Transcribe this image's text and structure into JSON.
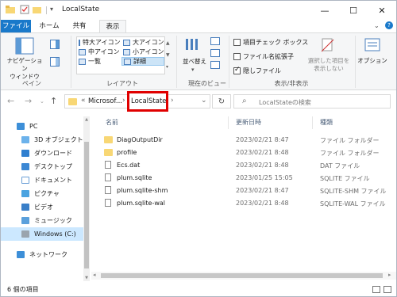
{
  "window": {
    "title": "LocalState",
    "minimize": "—",
    "maximize": "☐",
    "close": "✕"
  },
  "tabs": [
    {
      "label": "ファイル"
    },
    {
      "label": "ホーム"
    },
    {
      "label": "共有"
    },
    {
      "label": "表示"
    }
  ],
  "ribbon": {
    "pane": {
      "nav_pane_label": "ナビゲーション\nウィンドウ",
      "group_label": "ペイン"
    },
    "layout": {
      "items": [
        "特大アイコン",
        "大アイコン",
        "中アイコン",
        "小アイコン",
        "一覧",
        "詳細"
      ],
      "selected": "詳細",
      "group_label": "レイアウト"
    },
    "current_view": {
      "sort_label": "並べ替え",
      "group_label": "現在のビュー"
    },
    "show_hide": {
      "item_checkbox": "項目チェック ボックス",
      "extensions": "ファイル名拡張子",
      "hidden_items": "隠しファイル",
      "hide_selected": "選択した項目を\n表示しない",
      "group_label": "表示/非表示"
    },
    "options_label": "オプション"
  },
  "address": {
    "crumb_parent": "Microsof...",
    "crumb_current": "LocalState",
    "search_placeholder": "LocalStateの検索"
  },
  "sidebar": {
    "items": [
      {
        "label": "PC",
        "icon": "pc-icon"
      },
      {
        "label": "3D オブジェクト",
        "icon": "3d-objects-icon"
      },
      {
        "label": "ダウンロード",
        "icon": "download-icon"
      },
      {
        "label": "デスクトップ",
        "icon": "desktop-icon"
      },
      {
        "label": "ドキュメント",
        "icon": "documents-icon"
      },
      {
        "label": "ピクチャ",
        "icon": "pictures-icon"
      },
      {
        "label": "ビデオ",
        "icon": "video-icon"
      },
      {
        "label": "ミュージック",
        "icon": "music-icon"
      },
      {
        "label": "Windows (C:)",
        "icon": "drive-icon"
      },
      {
        "label": "ネットワーク",
        "icon": "network-icon"
      }
    ]
  },
  "list": {
    "headers": {
      "name": "名前",
      "date": "更新日時",
      "type": "種類"
    },
    "rows": [
      {
        "name": "DiagOutputDir",
        "date": "2023/02/21 8:47",
        "type": "ファイル フォルダー",
        "kind": "folder"
      },
      {
        "name": "profile",
        "date": "2023/02/21 8:48",
        "type": "ファイル フォルダー",
        "kind": "folder"
      },
      {
        "name": "Ecs.dat",
        "date": "2023/02/21 8:48",
        "type": "DAT ファイル",
        "kind": "file"
      },
      {
        "name": "plum.sqlite",
        "date": "2023/01/25 15:05",
        "type": "SQLITE ファイル",
        "kind": "file"
      },
      {
        "name": "plum.sqlite-shm",
        "date": "2023/02/21 8:47",
        "type": "SQLITE-SHM ファイル",
        "kind": "file"
      },
      {
        "name": "plum.sqlite-wal",
        "date": "2023/02/21 8:48",
        "type": "SQLITE-WAL ファイル",
        "kind": "file"
      }
    ]
  },
  "status": {
    "count": "6 個の項目"
  },
  "colors": {
    "accent": "#1979ca",
    "highlight": "#e00000",
    "folder": "#f8d775",
    "selected_bg": "#cce8ff"
  }
}
